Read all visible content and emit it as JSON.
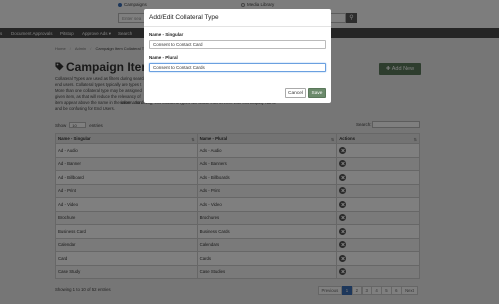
{
  "header": {
    "radio_campaigns": "Campaigns",
    "radio_media": "Media Library",
    "search_placeholder": "Enter sea",
    "search_icon_glyph": "⚲"
  },
  "nav": {
    "items": [
      "ls",
      "Document Approvals",
      "Pitstop",
      "Approve Ads ▾",
      "Search"
    ]
  },
  "breadcrumb": [
    "Home",
    "/",
    "Admin",
    "/",
    "Campaign Item Collateral Type"
  ],
  "page": {
    "title": "Campaign Item",
    "desc_lines": [
      "Collateral Types are used as filters during search",
      "end users. Collateral types typically are types t",
      "More than one collateral type may be assigned",
      "given item, as that will reduce the relevancy of",
      "item appear above the name in the information",
      "and be confusing for End Users."
    ],
    "desc_right": "They must",
    "desc_right2": "name ... to dialog, this collateral types will cause interference with this Display Name",
    "add_button": "✚ Add New"
  },
  "table_controls": {
    "show_label": "Show",
    "entries_value": "10",
    "entries_label": "entries",
    "search_label": "Search:"
  },
  "table": {
    "headers": [
      "Name - Singular",
      "Name - Plural",
      "Actions"
    ],
    "rows": [
      [
        "Ad - Audio",
        "Ads - Audio"
      ],
      [
        "Ad - Banner",
        "Ads - Banners"
      ],
      [
        "Ad - Billboard",
        "Ads - Billboards"
      ],
      [
        "Ad - Print",
        "Ads - Print"
      ],
      [
        "Ad - Video",
        "Ads - Video"
      ],
      [
        "Brochure",
        "Brochures"
      ],
      [
        "Business Card",
        "Business Cards"
      ],
      [
        "Calendar",
        "Calendars"
      ],
      [
        "Card",
        "Cards"
      ],
      [
        "Case Study",
        "Case Studies"
      ]
    ]
  },
  "footer": {
    "showing": "Showing 1 to 10 of 52 entries",
    "pager": [
      "Previous",
      "1",
      "2",
      "3",
      "4",
      "5",
      "6",
      "Next"
    ],
    "active_page": "1"
  },
  "modal": {
    "title": "Add/Edit Collateral Type",
    "singular_label": "Name - Singular",
    "singular_value": "Consent to Contact Card",
    "plural_label": "Name - Plural",
    "plural_value": "Consent to Contact Cards",
    "cancel": "Cancel",
    "save": "Save"
  },
  "colors": {
    "accent": "#3b6fb6",
    "add_button": "#5c7a5c",
    "save_button": "#6b8a6b",
    "nav_bar": "#4a4a4a"
  }
}
